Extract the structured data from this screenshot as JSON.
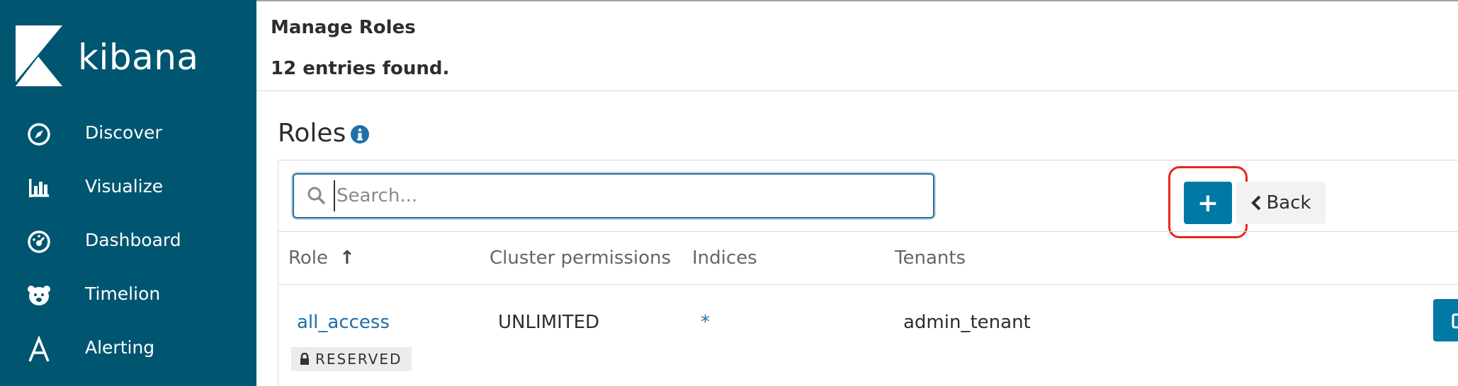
{
  "sidebar": {
    "logo_text": "kibana",
    "items": [
      {
        "label": "Discover",
        "icon": "compass-icon"
      },
      {
        "label": "Visualize",
        "icon": "bar-chart-icon"
      },
      {
        "label": "Dashboard",
        "icon": "dashboard-gauge-icon"
      },
      {
        "label": "Timelion",
        "icon": "bear-icon"
      },
      {
        "label": "Alerting",
        "icon": "letter-a-icon"
      }
    ]
  },
  "header": {
    "title": "Manage Roles",
    "count": "12 entries found."
  },
  "main": {
    "title": "Roles",
    "search": {
      "placeholder": "Search...",
      "value": ""
    },
    "add_label": "+",
    "back_label": "Back",
    "columns": [
      "Role",
      "Cluster permissions",
      "Indices",
      "Tenants"
    ],
    "sort_indicator": "↑",
    "rows": [
      {
        "role": "all_access",
        "cluster": "UNLIMITED",
        "indices": "*",
        "tenants": "admin_tenant",
        "badge": "RESERVED"
      }
    ]
  },
  "colors": {
    "sidebar": "#005571",
    "primary": "#0079a5",
    "link": "#1f6fa8",
    "highlight": "#e8271b"
  }
}
